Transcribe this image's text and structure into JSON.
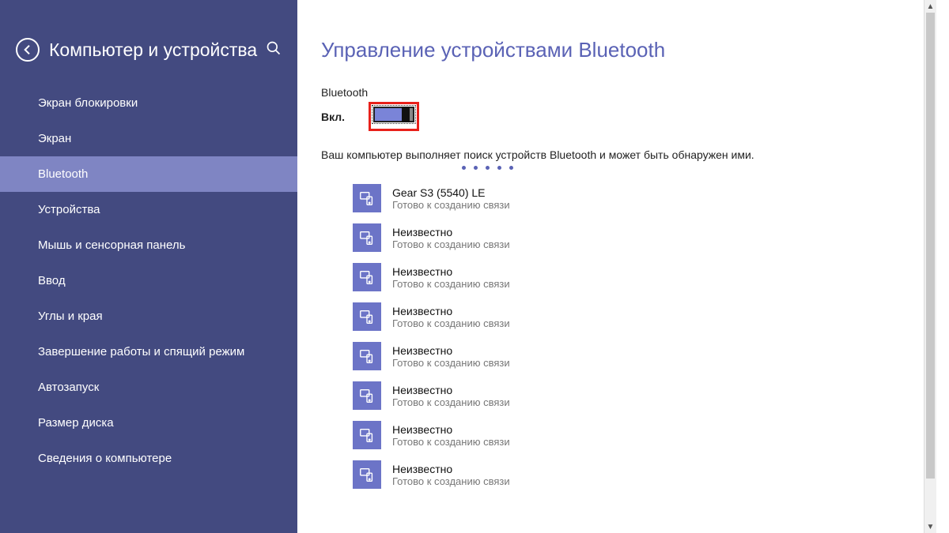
{
  "sidebar": {
    "title": "Компьютер и устройства",
    "items": [
      {
        "label": "Экран блокировки"
      },
      {
        "label": "Экран"
      },
      {
        "label": "Bluetooth",
        "selected": true
      },
      {
        "label": "Устройства"
      },
      {
        "label": "Мышь и сенсорная панель"
      },
      {
        "label": "Ввод"
      },
      {
        "label": "Углы и края"
      },
      {
        "label": "Завершение работы и спящий режим"
      },
      {
        "label": "Автозапуск"
      },
      {
        "label": "Размер диска"
      },
      {
        "label": "Сведения о компьютере"
      }
    ]
  },
  "main": {
    "title": "Управление устройствами Bluetooth",
    "toggle_label": "Bluetooth",
    "toggle_state": "Вкл.",
    "status_text": "Ваш компьютер выполняет поиск устройств Bluetooth и может быть обнаружен ими.",
    "devices": [
      {
        "name": "Gear S3 (5540) LE",
        "status": "Готово к созданию связи"
      },
      {
        "name": "Неизвестно",
        "status": "Готово к созданию связи"
      },
      {
        "name": "Неизвестно",
        "status": "Готово к созданию связи"
      },
      {
        "name": "Неизвестно",
        "status": "Готово к созданию связи"
      },
      {
        "name": "Неизвестно",
        "status": "Готово к созданию связи"
      },
      {
        "name": "Неизвестно",
        "status": "Готово к созданию связи"
      },
      {
        "name": "Неизвестно",
        "status": "Готово к созданию связи"
      },
      {
        "name": "Неизвестно",
        "status": "Готово к созданию связи"
      }
    ]
  }
}
